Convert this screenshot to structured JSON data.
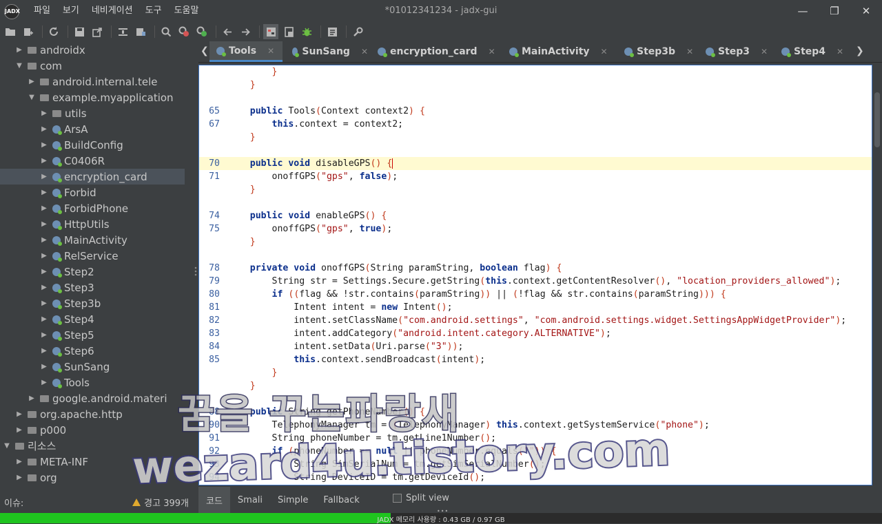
{
  "app": {
    "logo_text": "JADX",
    "window_title": "*01012341234 - jadx-gui",
    "menu": [
      "파일",
      "보기",
      "네비게이션",
      "도구",
      "도움말"
    ],
    "controls": {
      "minimize": "—",
      "maximize": "❐",
      "close": "✕"
    }
  },
  "toolbar": {
    "icons": [
      "open-folder-icon",
      "add-files-icon",
      "reload-icon",
      "save-icon",
      "export-icon",
      "sync-tree-icon",
      "flatten-packages-icon",
      "search-icon",
      "find-class-icon",
      "find-usage-icon",
      "back-icon",
      "forward-icon",
      "deobfuscation-icon",
      "code-comment-icon",
      "debug-icon",
      "log-icon",
      "settings-icon"
    ]
  },
  "tree": {
    "items": [
      {
        "label": "androidx",
        "indent": 1,
        "arrow": "▶",
        "icon": "folder"
      },
      {
        "label": "com",
        "indent": 1,
        "arrow": "▼",
        "icon": "folder"
      },
      {
        "label": "android.internal.tele",
        "indent": 2,
        "arrow": "▶",
        "icon": "folder"
      },
      {
        "label": "example.myapplication",
        "indent": 2,
        "arrow": "▼",
        "icon": "folder"
      },
      {
        "label": "utils",
        "indent": 3,
        "arrow": "▶",
        "icon": "folder"
      },
      {
        "label": "ArsA",
        "indent": 3,
        "arrow": "▶",
        "icon": "class"
      },
      {
        "label": "BuildConfig",
        "indent": 3,
        "arrow": "▶",
        "icon": "class"
      },
      {
        "label": "C0406R",
        "indent": 3,
        "arrow": "▶",
        "icon": "class"
      },
      {
        "label": "encryption_card",
        "indent": 3,
        "arrow": "▶",
        "icon": "class",
        "selected": true
      },
      {
        "label": "Forbid",
        "indent": 3,
        "arrow": "▶",
        "icon": "class"
      },
      {
        "label": "ForbidPhone",
        "indent": 3,
        "arrow": "▶",
        "icon": "class"
      },
      {
        "label": "HttpUtils",
        "indent": 3,
        "arrow": "▶",
        "icon": "class"
      },
      {
        "label": "MainActivity",
        "indent": 3,
        "arrow": "▶",
        "icon": "class"
      },
      {
        "label": "RelService",
        "indent": 3,
        "arrow": "▶",
        "icon": "class"
      },
      {
        "label": "Step2",
        "indent": 3,
        "arrow": "▶",
        "icon": "class"
      },
      {
        "label": "Step3",
        "indent": 3,
        "arrow": "▶",
        "icon": "class"
      },
      {
        "label": "Step3b",
        "indent": 3,
        "arrow": "▶",
        "icon": "class"
      },
      {
        "label": "Step4",
        "indent": 3,
        "arrow": "▶",
        "icon": "class"
      },
      {
        "label": "Step5",
        "indent": 3,
        "arrow": "▶",
        "icon": "class"
      },
      {
        "label": "Step6",
        "indent": 3,
        "arrow": "▶",
        "icon": "class"
      },
      {
        "label": "SunSang",
        "indent": 3,
        "arrow": "▶",
        "icon": "class"
      },
      {
        "label": "Tools",
        "indent": 3,
        "arrow": "▶",
        "icon": "class"
      },
      {
        "label": "google.android.materi",
        "indent": 2,
        "arrow": "▶",
        "icon": "folder"
      },
      {
        "label": "org.apache.http",
        "indent": 1,
        "arrow": "▶",
        "icon": "folder"
      },
      {
        "label": "p000",
        "indent": 1,
        "arrow": "▶",
        "icon": "folder"
      },
      {
        "label": "리소스",
        "indent": 0,
        "arrow": "▼",
        "icon": "folder"
      },
      {
        "label": "META-INF",
        "indent": 1,
        "arrow": "▶",
        "icon": "folder"
      },
      {
        "label": "org",
        "indent": 1,
        "arrow": "▶",
        "icon": "folder"
      }
    ]
  },
  "tabs": {
    "prev": "❮",
    "next": "❯",
    "items": [
      {
        "label": "Tools",
        "active": true
      },
      {
        "label": "SunSang",
        "active": false
      },
      {
        "label": "encryption_card",
        "active": false
      },
      {
        "label": "MainActivity",
        "active": false
      },
      {
        "label": "Step3b",
        "active": false
      },
      {
        "label": "Step3",
        "active": false
      },
      {
        "label": "Step4",
        "active": false
      }
    ]
  },
  "code": {
    "lines": [
      {
        "n": "",
        "t": "        }"
      },
      {
        "n": "",
        "t": "    }"
      },
      {
        "n": "",
        "t": ""
      },
      {
        "n": "65",
        "t": "    public Tools(Context context2) {"
      },
      {
        "n": "67",
        "t": "        this.context = context2;"
      },
      {
        "n": "",
        "t": "    }"
      },
      {
        "n": "",
        "t": ""
      },
      {
        "n": "70",
        "t": "    public void disableGPS() {",
        "highlight": true,
        "caret": true
      },
      {
        "n": "71",
        "t": "        onoffGPS(\"gps\", false);"
      },
      {
        "n": "",
        "t": "    }"
      },
      {
        "n": "",
        "t": ""
      },
      {
        "n": "74",
        "t": "    public void enableGPS() {"
      },
      {
        "n": "75",
        "t": "        onoffGPS(\"gps\", true);"
      },
      {
        "n": "",
        "t": "    }"
      },
      {
        "n": "",
        "t": ""
      },
      {
        "n": "78",
        "t": "    private void onoffGPS(String paramString, boolean flag) {"
      },
      {
        "n": "79",
        "t": "        String str = Settings.Secure.getString(this.context.getContentResolver(), \"location_providers_allowed\");"
      },
      {
        "n": "80",
        "t": "        if ((flag && !str.contains(paramString)) || (!flag && str.contains(paramString))) {"
      },
      {
        "n": "81",
        "t": "            Intent intent = new Intent();"
      },
      {
        "n": "82",
        "t": "            intent.setClassName(\"com.android.settings\", \"com.android.settings.widget.SettingsAppWidgetProvider\");"
      },
      {
        "n": "83",
        "t": "            intent.addCategory(\"android.intent.category.ALTERNATIVE\");"
      },
      {
        "n": "84",
        "t": "            intent.setData(Uri.parse(\"3\"));"
      },
      {
        "n": "85",
        "t": "            this.context.sendBroadcast(intent);"
      },
      {
        "n": "",
        "t": "        }"
      },
      {
        "n": "",
        "t": "    }"
      },
      {
        "n": "",
        "t": ""
      },
      {
        "n": "88",
        "t": "    public String getPhoneNumber() {"
      },
      {
        "n": "90",
        "t": "        TelephonyManager tm = (TelephonyManager) this.context.getSystemService(\"phone\");"
      },
      {
        "n": "91",
        "t": "        String phoneNumber = tm.getLine1Number();"
      },
      {
        "n": "92",
        "t": "        if (phoneNumber == null || phoneNumber.equals(\"\")) {"
      },
      {
        "n": "93",
        "t": "            String SimSerialNum = tm.getSimSerialNumber();"
      },
      {
        "n": "94",
        "t": "            String DeviceID = tm.getDeviceId();"
      }
    ]
  },
  "bottom": {
    "tabs": [
      {
        "label": "코드",
        "active": true
      },
      {
        "label": "Smali",
        "active": false
      },
      {
        "label": "Simple",
        "active": false
      },
      {
        "label": "Fallback",
        "active": false
      }
    ],
    "split_view": "Split view",
    "issues_label": "이슈:",
    "warnings": "경고 399개"
  },
  "status": {
    "memory_text": "JADX 메모리 사용량 : 0.43 GB / 0.97 GB",
    "memory_fraction": 0.443
  },
  "watermark": {
    "line1": "꿈을 꾸는파랑새",
    "line2": "wezard4u.tistory.com"
  }
}
